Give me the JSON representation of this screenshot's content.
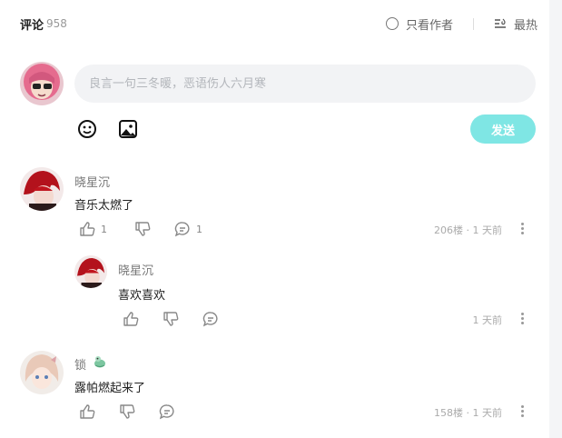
{
  "header": {
    "title": "评论",
    "count": "958",
    "author_only_label": "只看作者",
    "sort_label": "最热"
  },
  "composer": {
    "placeholder": "良言一句三冬暖，恶语伤人六月寒",
    "emoji_icon": "emoji-icon",
    "image_icon": "image-icon",
    "send_label": "发送"
  },
  "comments": [
    {
      "user": "晓星沉",
      "text": "音乐太燃了",
      "likes": "1",
      "replies": "1",
      "floor": "206楼",
      "time": "1 天前",
      "reply": {
        "user": "晓星沉",
        "text": "喜欢喜欢",
        "time": "1 天前"
      }
    },
    {
      "user": "锁",
      "text": "露帕燃起来了",
      "floor": "158楼",
      "time": "1 天前"
    }
  ],
  "meta_separator": "·",
  "colors": {
    "send_button": "#7fe6e4",
    "input_bg": "#f2f3f5"
  }
}
